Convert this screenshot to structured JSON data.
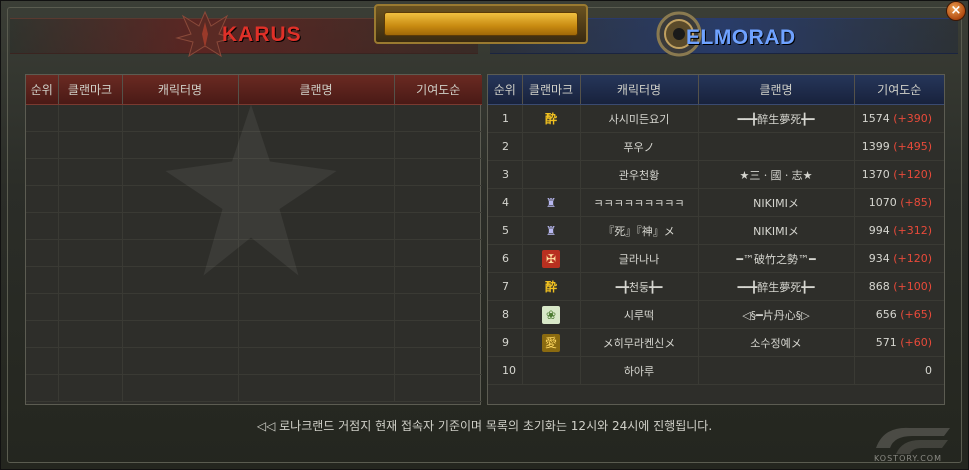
{
  "header": {
    "nation_left": "KARUS",
    "nation_right": "ELMORAD",
    "close_label": "×"
  },
  "colors": {
    "karus_red": "#e03028",
    "elmorad_blue": "#6fa2ff",
    "delta_red": "#e84a3a"
  },
  "columns": [
    "순위",
    "클랜마크",
    "캐릭터명",
    "클랜명",
    "기여도순"
  ],
  "karus": {
    "rows": []
  },
  "elmorad": {
    "rows": [
      {
        "rank": "1",
        "mark": "gold-sign",
        "glyph": "酔",
        "char": "사시미든요기",
        "clan": "━━╋醉生夢死╋━",
        "score": "1574",
        "delta": "(+390)"
      },
      {
        "rank": "2",
        "mark": "",
        "glyph": "",
        "char": "푸우ノ",
        "clan": "",
        "score": "1399",
        "delta": "(+495)"
      },
      {
        "rank": "3",
        "mark": "",
        "glyph": "",
        "char": "관우천황",
        "clan": "★三ㆍ國ㆍ志★",
        "score": "1370",
        "delta": "(+120)"
      },
      {
        "rank": "4",
        "mark": "castle",
        "glyph": "♜",
        "char": "ㅋㅋㅋㅋㅋㅋㅋㅋㅋ",
        "clan": "NIKIMIメ",
        "score": "1070",
        "delta": "(+85)"
      },
      {
        "rank": "5",
        "mark": "castle",
        "glyph": "♜",
        "char": "『死』『神』メ",
        "clan": "NIKIMIメ",
        "score": "994",
        "delta": "(+312)"
      },
      {
        "rank": "6",
        "mark": "red-crest",
        "glyph": "✠",
        "char": "글라나나",
        "clan": "━™破竹之勢™━",
        "score": "934",
        "delta": "(+120)"
      },
      {
        "rank": "7",
        "mark": "gold-sign",
        "glyph": "酔",
        "char": "━╋천둥╋━",
        "clan": "━━╋醉生夢死╋━",
        "score": "868",
        "delta": "(+100)"
      },
      {
        "rank": "8",
        "mark": "leaf",
        "glyph": "❀",
        "char": "시루떡",
        "clan": "◁§━片丹心§▷",
        "score": "656",
        "delta": "(+65)"
      },
      {
        "rank": "9",
        "mark": "amber",
        "glyph": "愛",
        "char": "メ히무라켄신メ",
        "clan": "소수정예メ",
        "score": "571",
        "delta": "(+60)"
      },
      {
        "rank": "10",
        "mark": "",
        "glyph": "",
        "char": "하아루",
        "clan": "",
        "score": "0",
        "delta": ""
      }
    ]
  },
  "footer": {
    "notice": "◁◁ 로나크랜드 거점지 현재 접속자 기준이며 목록의 초기화는 12시와 24시에 진행됩니다.",
    "logo_text": "KOSTORY.COM"
  }
}
